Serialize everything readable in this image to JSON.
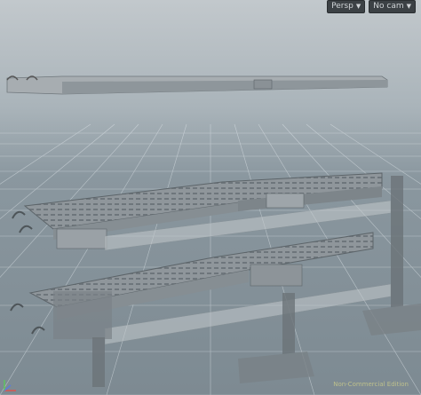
{
  "viewport": {
    "camera_mode": "Persp",
    "camera_select": "No cam",
    "watermark_text": "Non-Commercial Edition"
  },
  "icons": {
    "dropdown": "chevron-down-icon",
    "axes": "axis-gizmo-icon"
  },
  "colors": {
    "background_top": "#c2c8cc",
    "background_bottom": "#7d8a92",
    "grid": "#ffffff",
    "geometry": "#9aa1a6",
    "toolbar": "#3c4145",
    "axis_x": "#e0504a",
    "axis_y": "#5cc85c",
    "axis_z": "#5a7be0"
  }
}
